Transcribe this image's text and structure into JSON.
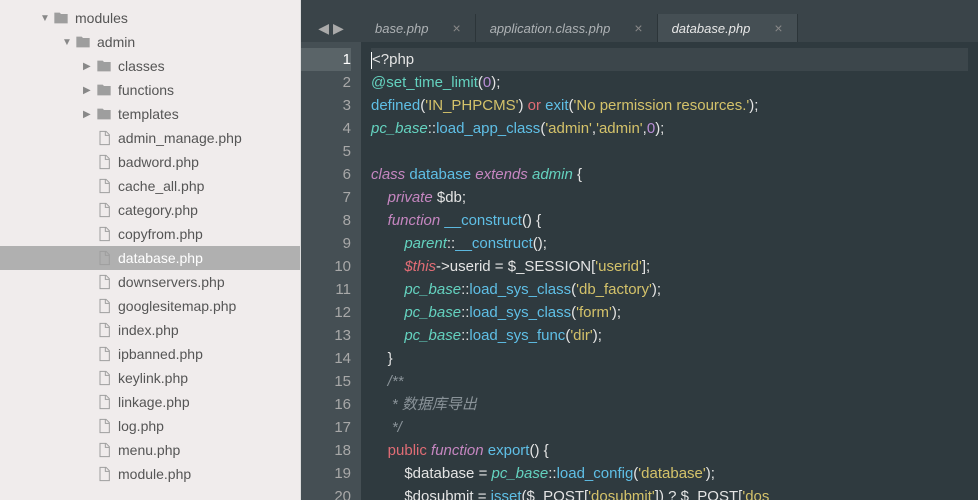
{
  "sidebar": {
    "folders": [
      {
        "name": "modules",
        "indent": 40,
        "open": true
      },
      {
        "name": "admin",
        "indent": 62,
        "open": true
      },
      {
        "name": "classes",
        "indent": 83,
        "open": false
      },
      {
        "name": "functions",
        "indent": 83,
        "open": false
      },
      {
        "name": "templates",
        "indent": 83,
        "open": false
      }
    ],
    "files": [
      "admin_manage.php",
      "badword.php",
      "cache_all.php",
      "category.php",
      "copyfrom.php",
      "database.php",
      "downservers.php",
      "googlesitemap.php",
      "index.php",
      "ipbanned.php",
      "keylink.php",
      "linkage.php",
      "log.php",
      "menu.php",
      "module.php"
    ],
    "selected": "database.php",
    "fileIndent": 83
  },
  "nav": {
    "back": "◀",
    "forward": "▶"
  },
  "tabs": [
    {
      "label": "base.php",
      "active": false
    },
    {
      "label": "application.class.php",
      "active": false
    },
    {
      "label": "database.php",
      "active": true
    }
  ],
  "code": {
    "lineCount": 20,
    "lines": [
      [
        {
          "t": "cursor"
        },
        {
          "c": "tag",
          "v": "<?php"
        }
      ],
      [
        {
          "c": "at",
          "v": "@set_time_limit"
        },
        {
          "c": "id",
          "v": "("
        },
        {
          "c": "num",
          "v": "0"
        },
        {
          "c": "id",
          "v": ");"
        }
      ],
      [
        {
          "c": "func",
          "v": "defined"
        },
        {
          "c": "id",
          "v": "("
        },
        {
          "c": "str",
          "v": "'IN_PHPCMS'"
        },
        {
          "c": "id",
          "v": ") "
        },
        {
          "c": "op",
          "v": "or"
        },
        {
          "c": "id",
          "v": " "
        },
        {
          "c": "func",
          "v": "exit"
        },
        {
          "c": "id",
          "v": "("
        },
        {
          "c": "str",
          "v": "'No permission resources.'"
        },
        {
          "c": "id",
          "v": ");"
        }
      ],
      [
        {
          "c": "cls",
          "v": "pc_base"
        },
        {
          "c": "id",
          "v": "::"
        },
        {
          "c": "func",
          "v": "load_app_class"
        },
        {
          "c": "id",
          "v": "("
        },
        {
          "c": "str",
          "v": "'admin'"
        },
        {
          "c": "id",
          "v": ","
        },
        {
          "c": "str",
          "v": "'admin'"
        },
        {
          "c": "id",
          "v": ","
        },
        {
          "c": "num",
          "v": "0"
        },
        {
          "c": "id",
          "v": ");"
        }
      ],
      [],
      [
        {
          "c": "key",
          "v": "class"
        },
        {
          "c": "id",
          "v": " "
        },
        {
          "c": "func",
          "v": "database"
        },
        {
          "c": "id",
          "v": " "
        },
        {
          "c": "key",
          "v": "extends"
        },
        {
          "c": "id",
          "v": " "
        },
        {
          "c": "cls",
          "v": "admin"
        },
        {
          "c": "id",
          "v": " {"
        }
      ],
      [
        {
          "c": "id",
          "v": "    "
        },
        {
          "c": "key",
          "v": "private"
        },
        {
          "c": "id",
          "v": " $db;"
        }
      ],
      [
        {
          "c": "id",
          "v": "    "
        },
        {
          "c": "key",
          "v": "function"
        },
        {
          "c": "id",
          "v": " "
        },
        {
          "c": "func",
          "v": "__construct"
        },
        {
          "c": "id",
          "v": "() {"
        }
      ],
      [
        {
          "c": "id",
          "v": "        "
        },
        {
          "c": "cls",
          "v": "parent"
        },
        {
          "c": "id",
          "v": "::"
        },
        {
          "c": "func",
          "v": "__construct"
        },
        {
          "c": "id",
          "v": "();"
        }
      ],
      [
        {
          "c": "id",
          "v": "        "
        },
        {
          "c": "var",
          "v": "$this"
        },
        {
          "c": "id",
          "v": "->userid = $_SESSION["
        },
        {
          "c": "str",
          "v": "'userid'"
        },
        {
          "c": "id",
          "v": "];"
        }
      ],
      [
        {
          "c": "id",
          "v": "        "
        },
        {
          "c": "cls",
          "v": "pc_base"
        },
        {
          "c": "id",
          "v": "::"
        },
        {
          "c": "func",
          "v": "load_sys_class"
        },
        {
          "c": "id",
          "v": "("
        },
        {
          "c": "str",
          "v": "'db_factory'"
        },
        {
          "c": "id",
          "v": ");"
        }
      ],
      [
        {
          "c": "id",
          "v": "        "
        },
        {
          "c": "cls",
          "v": "pc_base"
        },
        {
          "c": "id",
          "v": "::"
        },
        {
          "c": "func",
          "v": "load_sys_class"
        },
        {
          "c": "id",
          "v": "("
        },
        {
          "c": "str",
          "v": "'form'"
        },
        {
          "c": "id",
          "v": ");"
        }
      ],
      [
        {
          "c": "id",
          "v": "        "
        },
        {
          "c": "cls",
          "v": "pc_base"
        },
        {
          "c": "id",
          "v": "::"
        },
        {
          "c": "func",
          "v": "load_sys_func"
        },
        {
          "c": "id",
          "v": "("
        },
        {
          "c": "str",
          "v": "'dir'"
        },
        {
          "c": "id",
          "v": ");"
        }
      ],
      [
        {
          "c": "id",
          "v": "    }"
        }
      ],
      [
        {
          "c": "id",
          "v": "    "
        },
        {
          "c": "cmt",
          "v": "/**"
        }
      ],
      [
        {
          "c": "id",
          "v": "     "
        },
        {
          "c": "cmt",
          "v": "* 数据库导出"
        }
      ],
      [
        {
          "c": "id",
          "v": "     "
        },
        {
          "c": "cmt",
          "v": "*/"
        }
      ],
      [
        {
          "c": "id",
          "v": "    "
        },
        {
          "c": "pub",
          "v": "public"
        },
        {
          "c": "id",
          "v": " "
        },
        {
          "c": "key",
          "v": "function"
        },
        {
          "c": "id",
          "v": " "
        },
        {
          "c": "func",
          "v": "export"
        },
        {
          "c": "id",
          "v": "() {"
        }
      ],
      [
        {
          "c": "id",
          "v": "        $database = "
        },
        {
          "c": "cls",
          "v": "pc_base"
        },
        {
          "c": "id",
          "v": "::"
        },
        {
          "c": "func",
          "v": "load_config"
        },
        {
          "c": "id",
          "v": "("
        },
        {
          "c": "str",
          "v": "'database'"
        },
        {
          "c": "id",
          "v": ");"
        }
      ],
      [
        {
          "c": "id",
          "v": "        $dosubmit = "
        },
        {
          "c": "func",
          "v": "isset"
        },
        {
          "c": "id",
          "v": "($_POST["
        },
        {
          "c": "str",
          "v": "'dosubmit'"
        },
        {
          "c": "id",
          "v": "]) ? $_POST["
        },
        {
          "c": "str",
          "v": "'dos"
        }
      ]
    ]
  }
}
